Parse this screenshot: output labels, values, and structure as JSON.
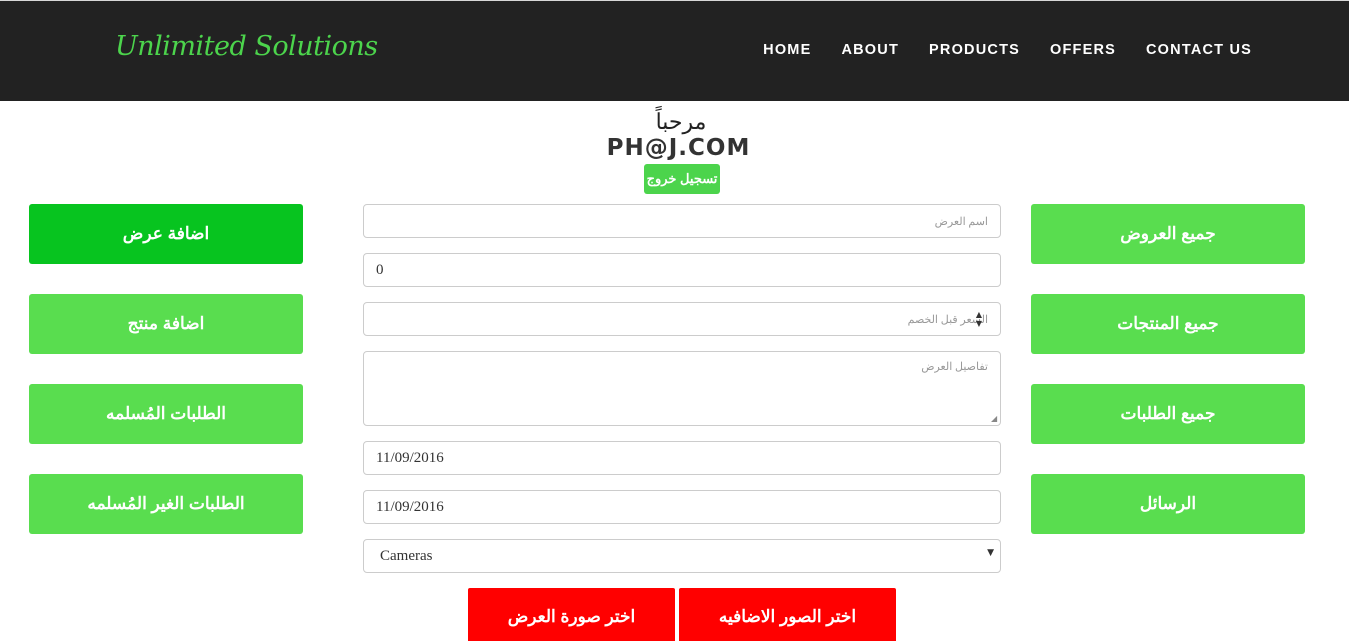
{
  "navbar": {
    "brand": "Unlimited Solutions",
    "links": [
      "HOME",
      "ABOUT",
      "PRODUCTS",
      "OFFERS",
      "CONTACT US"
    ]
  },
  "user": {
    "greeting": "مرحباً",
    "email": "PH@J.COM",
    "logout_label": "تسجيل خروج"
  },
  "left_menu": [
    "اضافة عرض",
    "اضافة منتج",
    "الطلبات المُسلمه",
    "الطلبات الغير المُسلمه"
  ],
  "right_menu": [
    "جميع العروض",
    "جميع المنتجات",
    "جميع الطلبات",
    "الرسائل"
  ],
  "form": {
    "offer_name_placeholder": "اسم العرض",
    "price_value": "0",
    "price_before_discount_placeholder": "السعر قبل الخصم",
    "details_placeholder": "تفاصيل العرض",
    "start_date": "11/09/2016",
    "end_date": "11/09/2016",
    "category_selected": "Cameras",
    "choose_extra_images_label": "اختر الصور الاضافيه",
    "choose_offer_image_label": "اختر صورة العرض"
  },
  "colors": {
    "navbar_bg": "#222222",
    "brand": "#4cd44c",
    "menu_button": "#59dd4f",
    "menu_button_active": "#07c41f",
    "upload_button": "#ff0000"
  }
}
